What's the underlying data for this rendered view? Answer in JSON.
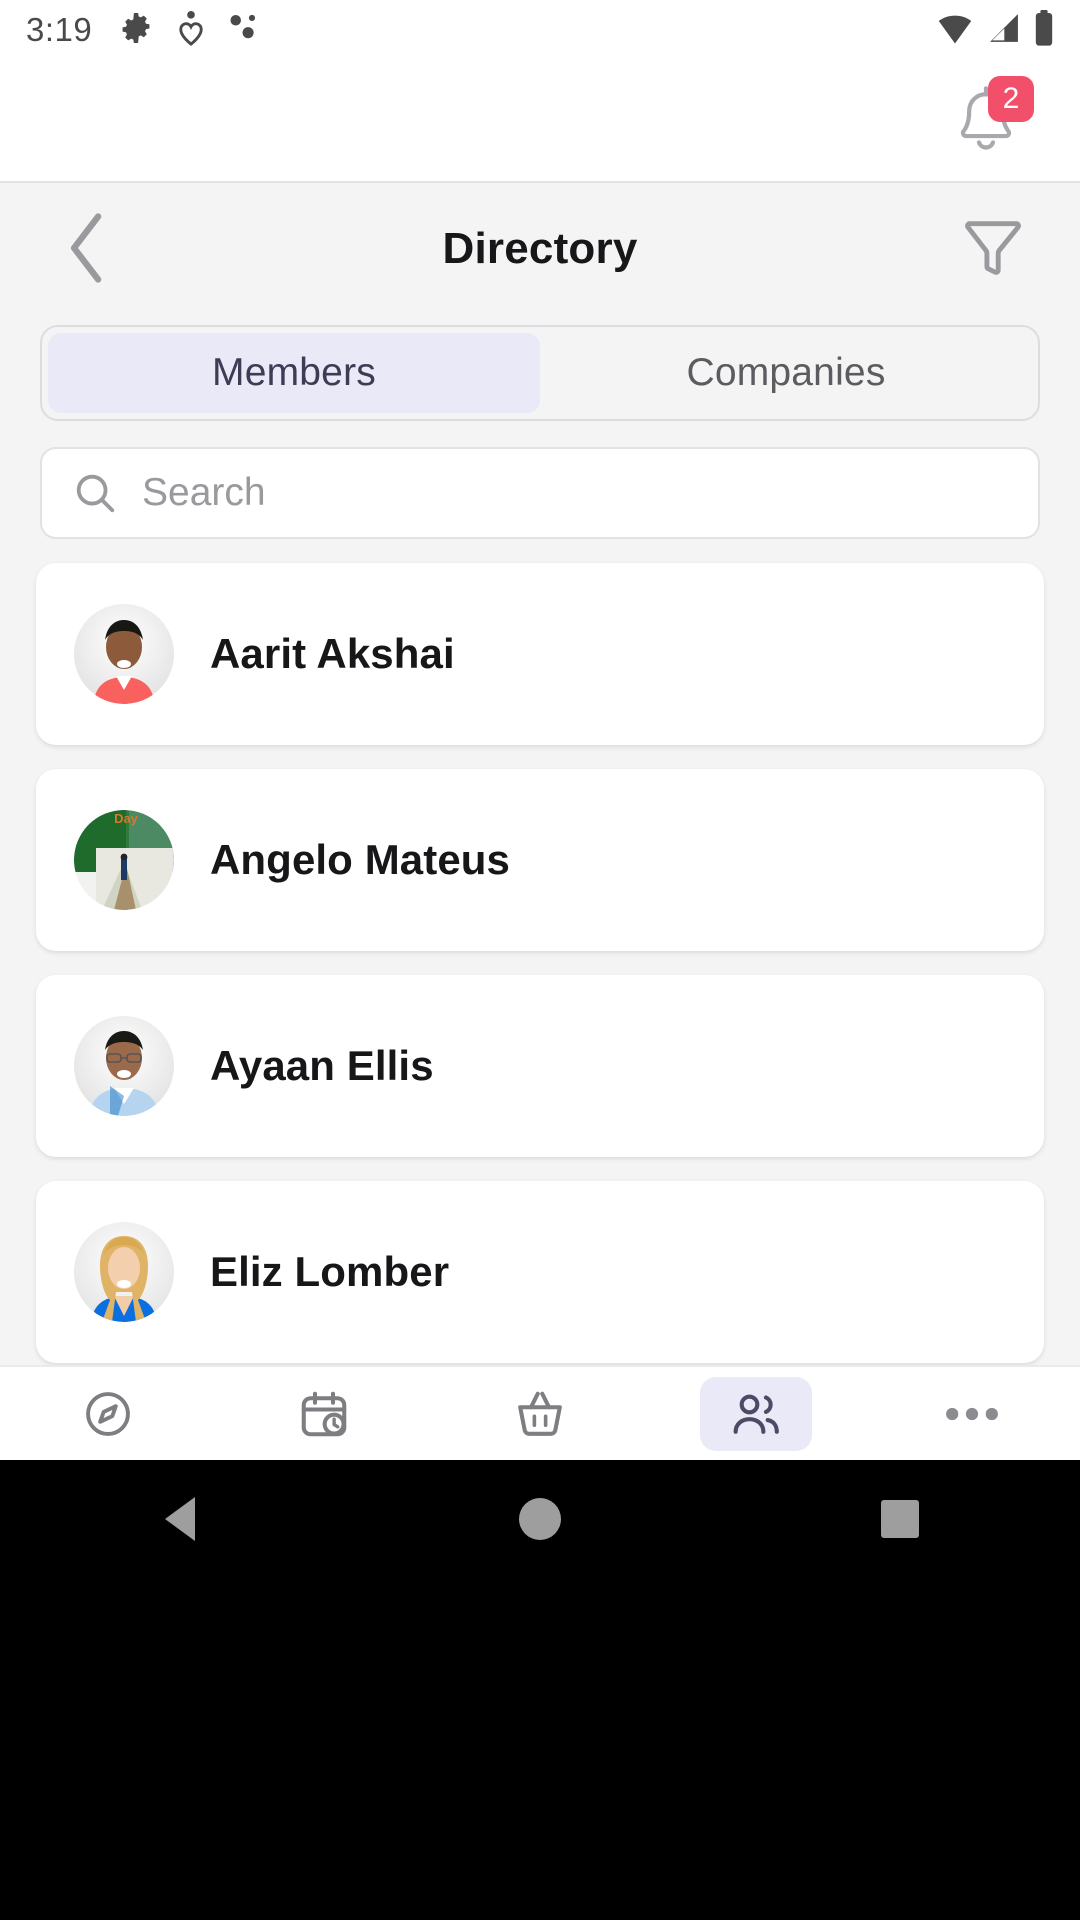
{
  "status_bar": {
    "time": "3:19",
    "left_icons": [
      "gear-icon",
      "heart-location-icon",
      "dots-icon"
    ],
    "right_icons": [
      "wifi-icon",
      "cellular-signal-icon",
      "battery-icon"
    ]
  },
  "app_bar": {
    "notification_icon": "bell-icon",
    "notification_count": "2",
    "badge_color": "#f2506a"
  },
  "page": {
    "title": "Directory",
    "back_icon": "chevron-left-icon",
    "filter_icon": "funnel-filter-icon"
  },
  "tabs": {
    "active_index": 0,
    "active_bg": "#e9e9f7",
    "active_text_color": "#3c3c55",
    "items": [
      {
        "label": "Members"
      },
      {
        "label": "Companies"
      }
    ]
  },
  "search": {
    "icon": "search-icon",
    "placeholder": "Search",
    "value": ""
  },
  "members": [
    {
      "name": "Aarit Akshai",
      "avatar": "photo-man-salmon-polo"
    },
    {
      "name": "Angelo Mateus",
      "avatar": "photo-green-path-scene"
    },
    {
      "name": "Ayaan Ellis",
      "avatar": "photo-man-glasses-blue-shirt"
    },
    {
      "name": "Eliz Lomber",
      "avatar": "photo-woman-blonde-blue-top"
    }
  ],
  "bottom_nav": {
    "active_index": 3,
    "active_bg": "#e9e9f7",
    "items": [
      {
        "icon": "compass-gauge-icon"
      },
      {
        "icon": "calendar-clock-icon"
      },
      {
        "icon": "shopping-basket-icon"
      },
      {
        "icon": "people-icon"
      },
      {
        "icon": "more-horizontal-icon"
      }
    ]
  },
  "android_nav": {
    "back": "back-triangle-icon",
    "home": "home-circle-icon",
    "recents": "recents-square-icon"
  }
}
